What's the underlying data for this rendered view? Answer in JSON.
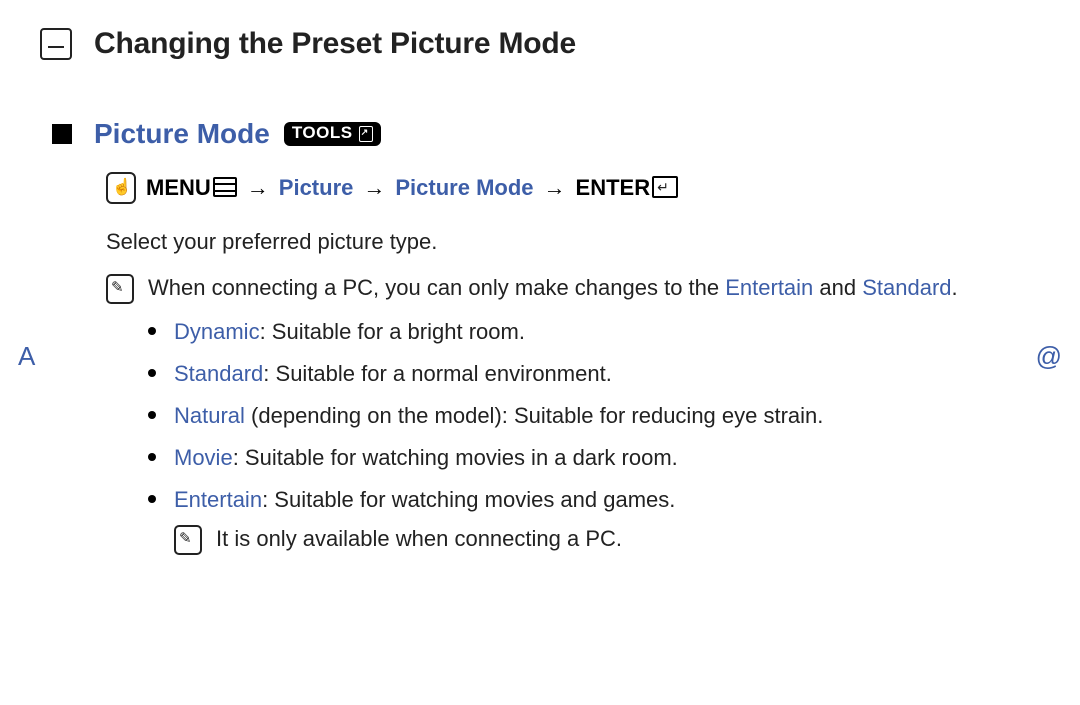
{
  "title": "Changing the Preset Picture Mode",
  "section": {
    "heading": "Picture Mode",
    "tools_label": "TOOLS"
  },
  "path": {
    "menu_label": "MENU",
    "picture": "Picture",
    "picture_mode": "Picture Mode",
    "enter_label": "ENTER",
    "arrow": "→"
  },
  "intro": "Select your preferred picture type.",
  "pc_note": {
    "prefix": "When connecting a PC, you can only make changes to the ",
    "entertain": "Entertain",
    "and": " and ",
    "standard": "Standard",
    "suffix": "."
  },
  "modes": [
    {
      "name": "Dynamic",
      "desc": ": Suitable for a bright room."
    },
    {
      "name": "Standard",
      "desc": ": Suitable for a normal environment."
    },
    {
      "name": "Natural",
      "desc": " (depending on the model): Suitable for reducing eye strain."
    },
    {
      "name": "Movie",
      "desc": ": Suitable for watching movies in a dark room."
    },
    {
      "name": "Entertain",
      "desc": ": Suitable for watching movies and games."
    }
  ],
  "entertain_subnote": "It is only available when connecting a PC.",
  "nav": {
    "prev": "A",
    "next": "@"
  }
}
